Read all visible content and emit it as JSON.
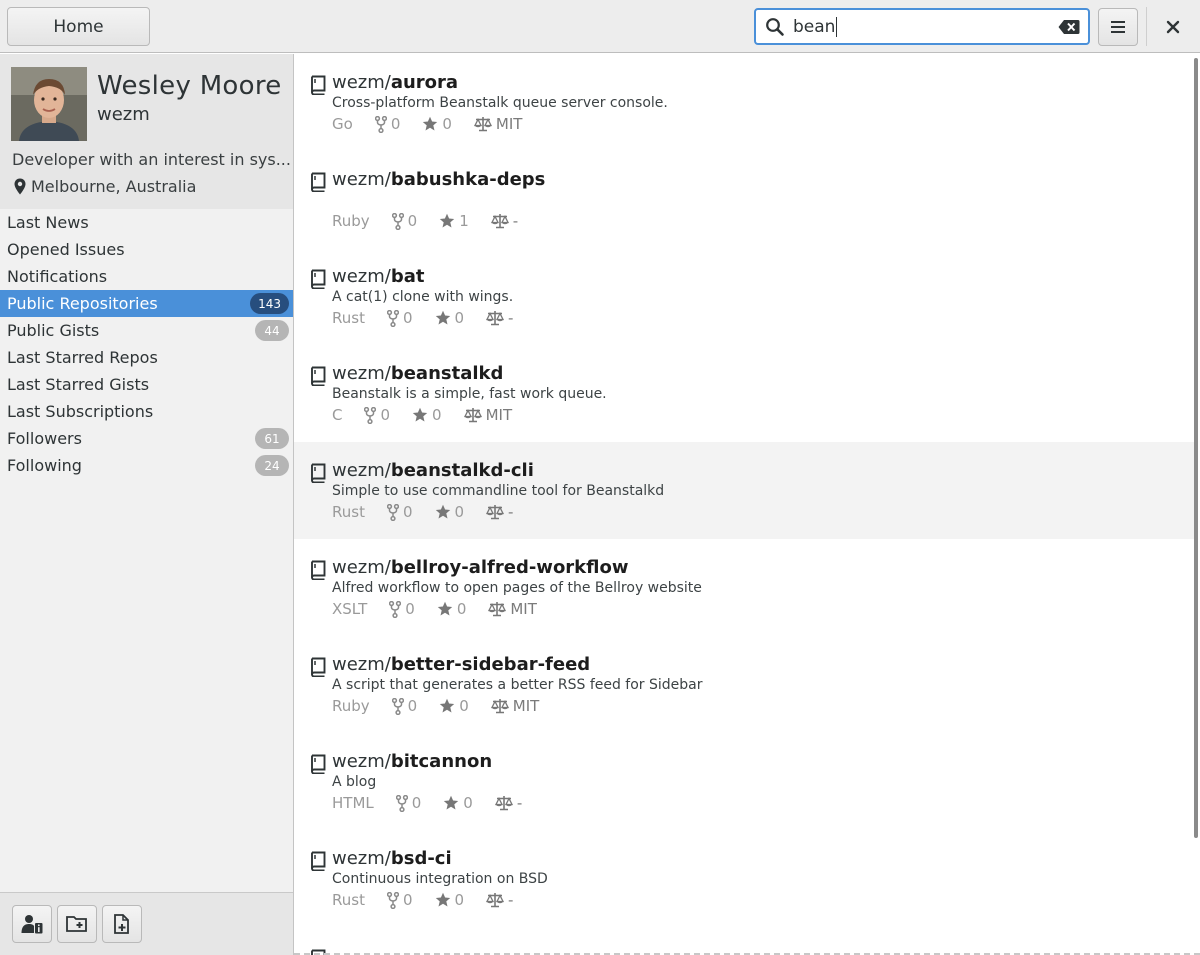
{
  "header": {
    "home_label": "Home",
    "search_value": "bean"
  },
  "profile": {
    "name": "Wesley Moore",
    "login": "wezm",
    "bio": "Developer with an interest in sys...",
    "location": "Melbourne, Australia"
  },
  "sidebar": {
    "items": [
      {
        "label": "Last News",
        "badge": ""
      },
      {
        "label": "Opened Issues",
        "badge": ""
      },
      {
        "label": "Notifications",
        "badge": ""
      },
      {
        "label": "Public Repositories",
        "badge": "143",
        "active": true
      },
      {
        "label": "Public Gists",
        "badge": "44"
      },
      {
        "label": "Last Starred Repos",
        "badge": ""
      },
      {
        "label": "Last Starred Gists",
        "badge": ""
      },
      {
        "label": "Last Subscriptions",
        "badge": ""
      },
      {
        "label": "Followers",
        "badge": "61"
      },
      {
        "label": "Following",
        "badge": "24"
      }
    ]
  },
  "footer_icons": [
    "user-info-icon",
    "new-folder-icon",
    "new-file-icon"
  ],
  "repos": [
    {
      "owner": "wezm/",
      "name": "aurora",
      "desc": "Cross-platform Beanstalk queue server console.",
      "lang": "Go",
      "forks": "0",
      "stars": "0",
      "license": "MIT"
    },
    {
      "owner": "wezm/",
      "name": "babushka-deps",
      "desc": "",
      "lang": "Ruby",
      "forks": "0",
      "stars": "1",
      "license": "-"
    },
    {
      "owner": "wezm/",
      "name": "bat",
      "desc": "A cat(1) clone with wings.",
      "lang": "Rust",
      "forks": "0",
      "stars": "0",
      "license": "-"
    },
    {
      "owner": "wezm/",
      "name": "beanstalkd",
      "desc": "Beanstalk is a simple, fast work queue.",
      "lang": "C",
      "forks": "0",
      "stars": "0",
      "license": "MIT"
    },
    {
      "owner": "wezm/",
      "name": "beanstalkd-cli",
      "desc": "Simple to use commandline tool for Beanstalkd",
      "lang": "Rust",
      "forks": "0",
      "stars": "0",
      "license": "-",
      "hover": true
    },
    {
      "owner": "wezm/",
      "name": "bellroy-alfred-workflow",
      "desc": "Alfred workflow to open pages of the Bellroy website",
      "lang": "XSLT",
      "forks": "0",
      "stars": "0",
      "license": "MIT"
    },
    {
      "owner": "wezm/",
      "name": "better-sidebar-feed",
      "desc": "A script that generates a better RSS feed for Sidebar",
      "lang": "Ruby",
      "forks": "0",
      "stars": "0",
      "license": "MIT"
    },
    {
      "owner": "wezm/",
      "name": "bitcannon",
      "desc": "A blog",
      "lang": "HTML",
      "forks": "0",
      "stars": "0",
      "license": "-"
    },
    {
      "owner": "wezm/",
      "name": "bsd-ci",
      "desc": "Continuous integration on BSD",
      "lang": "Rust",
      "forks": "0",
      "stars": "0",
      "license": "-"
    }
  ],
  "colors": {
    "accent": "#4a90d9",
    "badge": "#b5b5b5",
    "active_badge": "#274e7e"
  }
}
